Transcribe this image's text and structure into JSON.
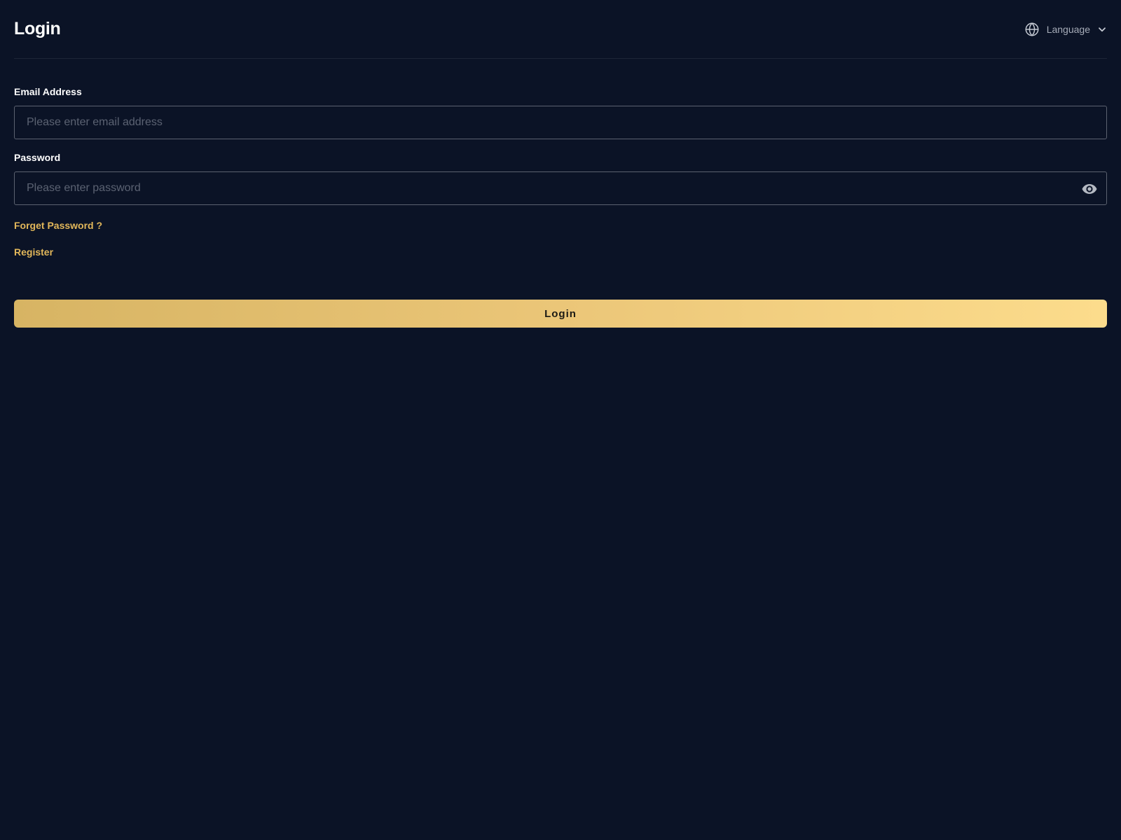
{
  "header": {
    "title": "Login",
    "language_label": "Language"
  },
  "form": {
    "email": {
      "label": "Email Address",
      "placeholder": "Please enter email address",
      "value": ""
    },
    "password": {
      "label": "Password",
      "placeholder": "Please enter password",
      "value": ""
    },
    "forget_password_label": "Forget Password ?",
    "register_label": "Register",
    "submit_label": "Login"
  },
  "icons": {
    "language": "globe-icon",
    "language_dropdown": "chevron-down-icon",
    "password_toggle": "eye-icon"
  },
  "colors": {
    "background": "#0b1326",
    "accent": "#e2b75a",
    "button_gradient_start": "#d7b463",
    "button_gradient_end": "#fcdc8c"
  }
}
